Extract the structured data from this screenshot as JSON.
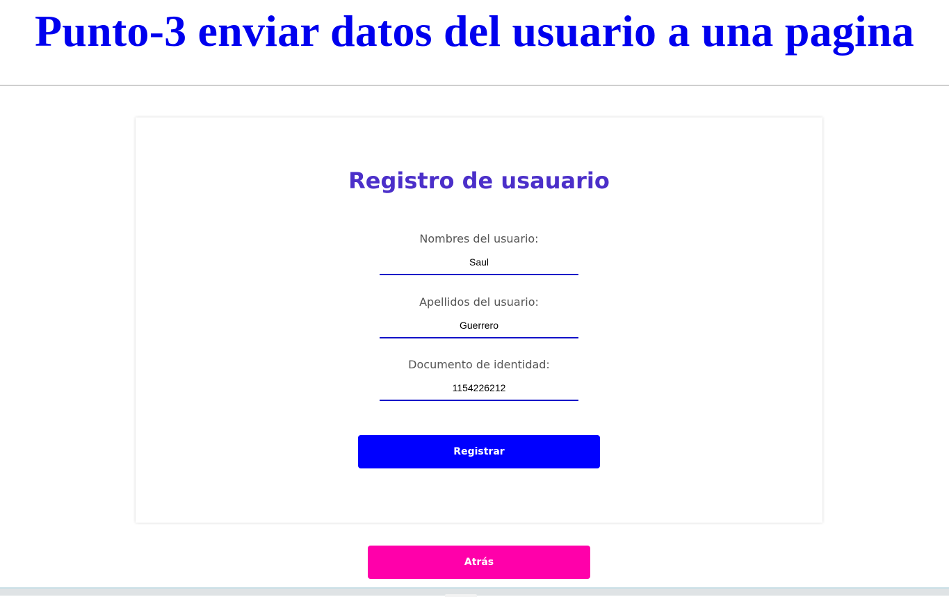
{
  "page": {
    "title": "Punto-3 enviar datos del usuario a una pagina"
  },
  "form": {
    "title": "Registro de usauario",
    "fields": [
      {
        "label": "Nombres del usuario:",
        "value": "Saul"
      },
      {
        "label": "Apellidos del usuario:",
        "value": "Guerrero"
      },
      {
        "label": "Documento de identidad:",
        "value": "1154226212"
      }
    ],
    "submit_label": "Registrar"
  },
  "back_label": "Atrás",
  "colors": {
    "page_title": "#0000ee",
    "form_title": "#4b2fc9",
    "input_underline": "#1111c8",
    "register_button": "#0000ff",
    "back_button": "#ff00aa"
  }
}
